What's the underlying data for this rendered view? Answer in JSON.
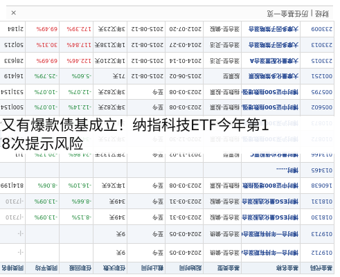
{
  "panel": {
    "title": "财经 | 历任基金一览",
    "close": "×"
  },
  "headers": [
    "基金代码",
    "基金名称",
    "基金类型",
    "起始时间",
    "截止时间",
    "任职天数",
    "任职回报",
    "同类平均",
    "同类排名"
  ],
  "rows": [
    {
      "code": "019712",
      "name": "博时合一年持有期混合A",
      "type": "混合型-偏债",
      "start": "2024-03-05",
      "end": "至今",
      "days": "9天",
      "ret": "",
      "avg": "",
      "rank": "-|-"
    },
    {
      "code": "019713",
      "name": "博时合一年持有期混合C",
      "type": "混合型-偏债",
      "start": "2024-03-05",
      "end": "至今",
      "days": "9天",
      "ret": "",
      "avg": "",
      "rank": "-|-"
    },
    {
      "code": "018130",
      "name": "博时ESG量化选股混合A",
      "type": "混合型-偏股",
      "start": "2023-03-31",
      "end": "至今",
      "days": "349天",
      "ret": "-8.15%",
      "avg": "-13.09%",
      "rank": "-|7310"
    },
    {
      "code": "018131",
      "name": "博时ESG量化选股混合C",
      "type": "混合型-偏股",
      "start": "2023-03-31",
      "end": "至今",
      "days": "349天",
      "ret": "-8.66%",
      "avg": "-13.09%",
      "rank": "-|7310"
    },
    {
      "code": "160638",
      "name": "博时中证800增强指数",
      "type": "指数型-股票",
      "start": "2023-03-08",
      "end": "至今",
      "days": "1年又6天",
      "ret": "-16.10%",
      "avg": "-8.06%",
      "rank": "814|1998"
    },
    {
      "code": "013465",
      "name": "博时……",
      "type": "",
      "start": "",
      "end": "",
      "days": "",
      "ret": "",
      "avg": "",
      "rank": ""
    },
    {
      "code": "013466",
      "name": "博时量化价值股票C",
      "type": "股票型",
      "start": "2021-11-02",
      "end": "至今",
      "days": "2年又132天",
      "ret": "-24.86%",
      "avg": "-20.17%",
      "rank": "1|1"
    },
    {
      "code": "010872",
      "name": "博时沪深300指数增强A",
      "type": "指数型-股票",
      "start": "2020-12-30",
      "end": "至今",
      "days": "3年又75天",
      "ret": "-34.24%",
      "avg": "-17.21%",
      "rank": "1378|1565"
    },
    {
      "code": "010873",
      "name": "博时沪深300指数增强C",
      "type": "指数型-股票",
      "start": "2020-12-30",
      "end": "至今",
      "days": "3年又75天",
      "ret": "-34.63%",
      "avg": "-17.21%",
      "rank": "1386|1565"
    },
    {
      "code": "005602",
      "name": "博时中证500指数增强A",
      "type": "指数型-股票",
      "start": "2023-03-08",
      "end": "至今",
      "days": "3年又82天",
      "ret": "-12.14%",
      "avg": "-10.07%",
      "rank": "500|1541"
    },
    {
      "code": "005795",
      "name": "博时中证500指数增强C",
      "type": "指数型-股票",
      "start": "2023-03-08",
      "end": "至今",
      "days": "3年又82天",
      "ret": "-12.07%",
      "avg": "-10.07%",
      "rank": "531|1541"
    },
    {
      "code": "001251",
      "name": "大摩量化多策略股票",
      "type": "股票型",
      "start": "2015-06-02",
      "end": "2015-08-12",
      "days": "71天",
      "ret": "-5.60%",
      "avg": "-25.79%",
      "rank": "16|419"
    },
    {
      "code": "233015",
      "name": "大摩量化配置混合A",
      "type": "混合型-灵活",
      "start": "2014-01-14",
      "end": "2015-08-12",
      "days": "1年又210天",
      "ret": "122.46%",
      "avg": "69.69%",
      "rank": "28|633"
    },
    {
      "code": "233013",
      "name": "大摩多因子策略混合",
      "type": "混合型-灵活",
      "start": "2014-03-27",
      "end": "2015-08-12",
      "days": "1年又138天",
      "ret": "117.84%",
      "avg": "30.31%",
      "rank": "50|215"
    },
    {
      "code": "233009",
      "name": "大摩多因子策略混合",
      "type": "混合型-偏股",
      "start": "2012-07-20",
      "end": "2015-08-12",
      "days": "3年又23天",
      "ret": "172.39%",
      "avg": "69.49%",
      "rank": "2|184"
    }
  ],
  "overlay": {
    "line1": "又有爆款债基成立！纳指科技ETF今年第1",
    "line2": "8次提示风险"
  }
}
